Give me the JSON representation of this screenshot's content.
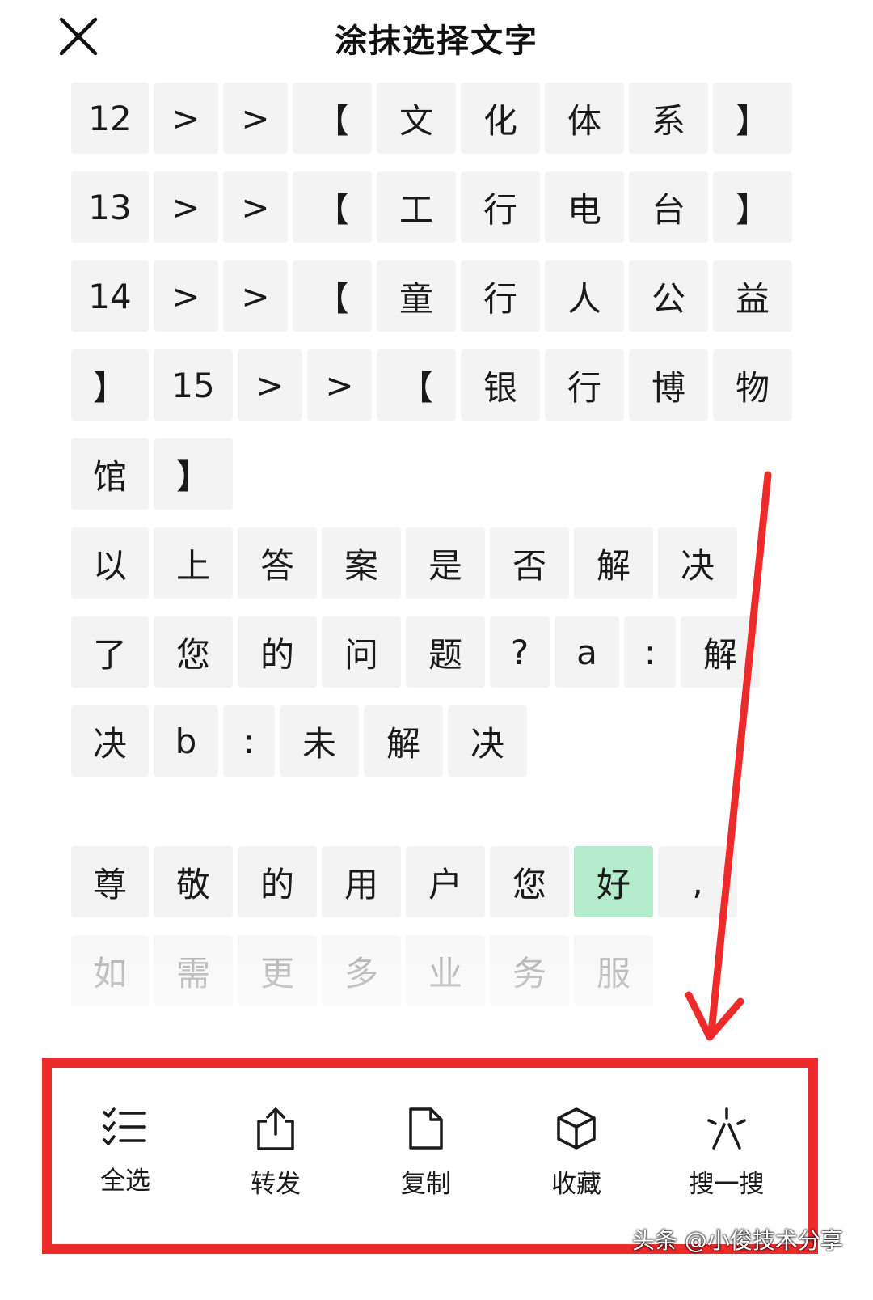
{
  "header": {
    "title": "涂抹选择文字",
    "close_icon": "close-icon"
  },
  "grid_rows": [
    [
      "12",
      ">",
      ">",
      "【",
      "文",
      "化",
      "体",
      "系",
      "】"
    ],
    [
      "13",
      ">",
      ">",
      "【",
      "工",
      "行",
      "电",
      "台",
      "】"
    ],
    [
      "14",
      ">",
      ">",
      "【",
      "童",
      "行",
      "人",
      "公",
      "益"
    ],
    [
      "】",
      "15",
      ">",
      ">",
      "【",
      "银",
      "行",
      "博",
      "物"
    ],
    [
      "馆",
      "】"
    ],
    [
      "以",
      "上",
      "答",
      "案",
      "是",
      "否",
      "解",
      "决"
    ],
    [
      "了",
      "您",
      "的",
      "问",
      "题",
      "?",
      "a",
      ":",
      "解"
    ],
    [
      "决",
      "b",
      ":",
      "未",
      "解",
      "决"
    ],
    [
      "尊",
      "敬",
      "的",
      "用",
      "户",
      "您",
      "好",
      ","
    ],
    [
      "如",
      "需",
      "更",
      "多",
      "业",
      "务",
      "服"
    ]
  ],
  "selected_char": "好",
  "toolbar": {
    "items": [
      {
        "label": "全选",
        "icon": "select-all-icon"
      },
      {
        "label": "转发",
        "icon": "share-icon"
      },
      {
        "label": "复制",
        "icon": "copy-icon"
      },
      {
        "label": "收藏",
        "icon": "cube-icon"
      },
      {
        "label": "搜一搜",
        "icon": "search-spark-icon"
      }
    ]
  },
  "annotation": {
    "color": "#ee2b2b"
  },
  "colors": {
    "selected_bg": "#b4ebcd",
    "cell_bg": "#f3f3f3"
  },
  "watermark": "头条 @小俊技术分享"
}
